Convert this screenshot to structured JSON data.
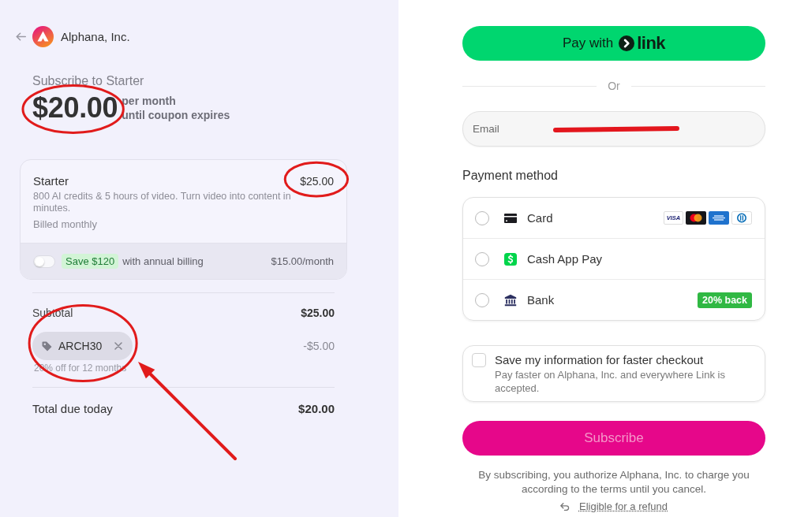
{
  "header": {
    "company": "Alphana, Inc."
  },
  "summary": {
    "title": "Subscribe to Starter",
    "price": "$20.00",
    "price_circled": true,
    "period": "per month",
    "note": "until coupon expires"
  },
  "plan": {
    "name": "Starter",
    "price": "$25.00",
    "price_circled": true,
    "description": "800 AI credits & 5 hours of video. Turn video into content in minutes.",
    "billing": "Billed monthly",
    "annual": {
      "on": false,
      "badge": "Save $120",
      "text": "with annual billing",
      "price": "$15.00/month"
    }
  },
  "subtotal": {
    "label": "Subtotal",
    "amount": "$25.00"
  },
  "coupon": {
    "code": "ARCH30",
    "amount": "-$5.00",
    "note": "20% off for 12 months",
    "circled": true,
    "arrow": true
  },
  "total": {
    "label": "Total due today",
    "amount": "$20.00"
  },
  "link_button": {
    "label": "Pay with",
    "brand": "link"
  },
  "separator": "Or",
  "email": {
    "label": "Email",
    "redacted": true
  },
  "payment": {
    "title": "Payment method",
    "methods": [
      {
        "kind": "card",
        "label": "Card",
        "selected": false,
        "brands": [
          {
            "kind": "visa",
            "label": "VISA"
          },
          {
            "kind": "mastercard"
          },
          {
            "kind": "amex"
          },
          {
            "kind": "diners"
          }
        ]
      },
      {
        "kind": "cashapp",
        "label": "Cash App Pay",
        "selected": false
      },
      {
        "kind": "bank",
        "label": "Bank",
        "selected": false,
        "badge": "20% back"
      }
    ]
  },
  "save_info": {
    "checked": false,
    "title": "Save my information for faster checkout",
    "description": "Pay faster on Alphana, Inc. and everywhere Link is accepted."
  },
  "subscribe": {
    "label": "Subscribe",
    "disabled": true
  },
  "legal": "By subscribing, you authorize Alphana, Inc. to charge you according to the terms until you cancel.",
  "refund_link": "Eligible for a refund"
}
